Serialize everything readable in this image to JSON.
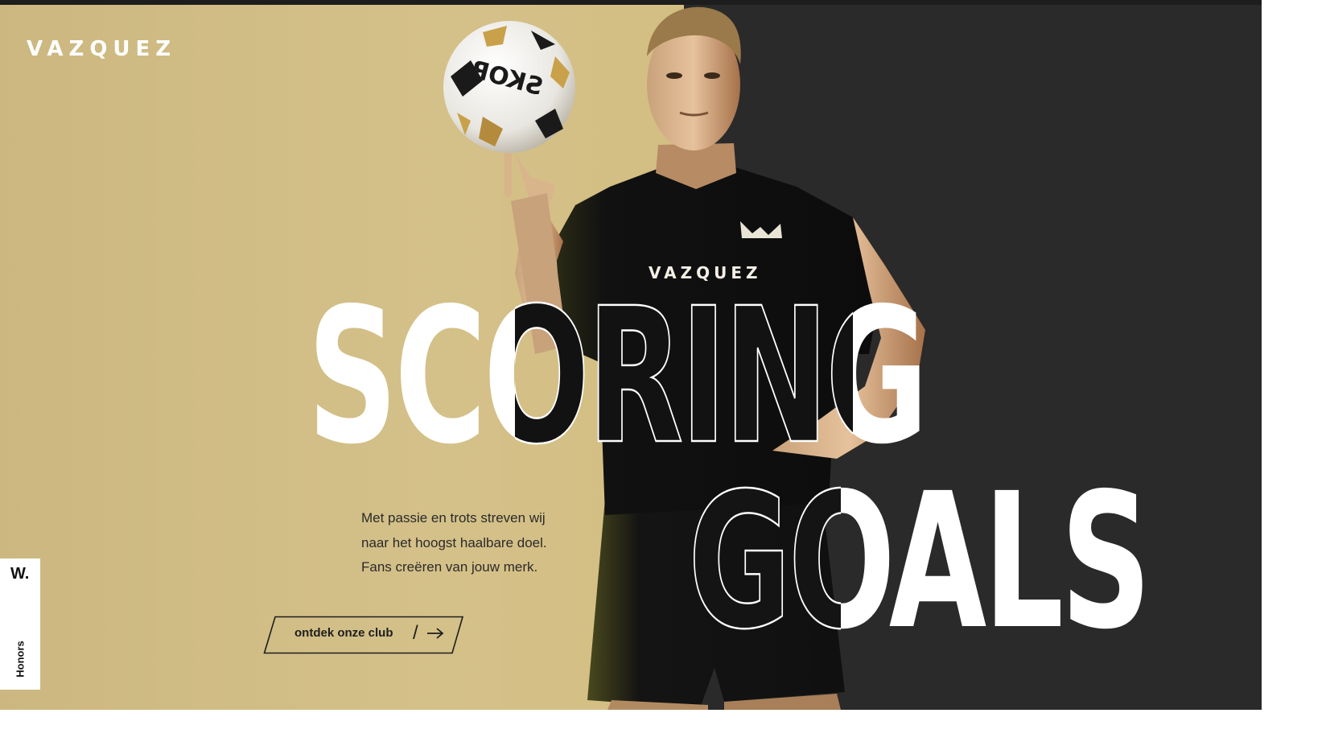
{
  "brand": {
    "logo_text": "VAZQUEZ"
  },
  "hero": {
    "headline_line1": "SCORING",
    "headline_line2": "GOALS",
    "shirt_text": "VAZQUEZ",
    "ball_text": "SKOR"
  },
  "tagline": {
    "lines": [
      "Met passie en trots streven wij",
      "naar het hoogst haalbare doel.",
      "Fans creëren van jouw merk."
    ]
  },
  "cta": {
    "label": "ontdek onze club",
    "separator": "/",
    "icon": "arrow-right-icon"
  },
  "honors_badge": {
    "logo_text": "W.",
    "label": "Honors"
  },
  "colors": {
    "gold_background": "#d4c189",
    "dark_panel": "#2b2a2a",
    "headline": "#ffffff",
    "text_dark": "#2b2a2a"
  }
}
